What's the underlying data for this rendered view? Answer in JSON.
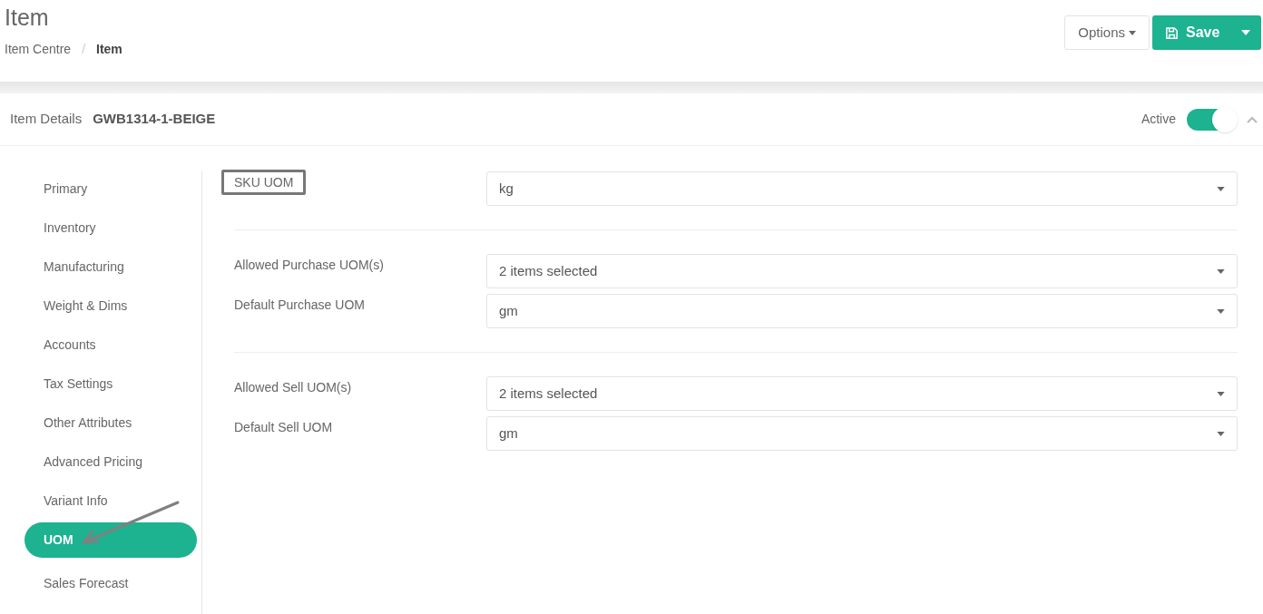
{
  "page": {
    "title": "Item",
    "breadcrumb": [
      {
        "label": "Item Centre",
        "current": false
      },
      {
        "label": "Item",
        "current": true
      }
    ],
    "separator": "/"
  },
  "actions": {
    "options": "Options",
    "save": "Save"
  },
  "details": {
    "label": "Item Details",
    "code": "GWB1314-1-BEIGE",
    "status_label": "Active",
    "active": true,
    "expanded": true
  },
  "sidebar": {
    "items": [
      {
        "label": "Primary",
        "selected": false
      },
      {
        "label": "Inventory",
        "selected": false
      },
      {
        "label": "Manufacturing",
        "selected": false
      },
      {
        "label": "Weight & Dims",
        "selected": false
      },
      {
        "label": "Accounts",
        "selected": false
      },
      {
        "label": "Tax Settings",
        "selected": false
      },
      {
        "label": "Other Attributes",
        "selected": false
      },
      {
        "label": "Advanced Pricing",
        "selected": false
      },
      {
        "label": "Variant Info",
        "selected": false
      },
      {
        "label": "UOM",
        "selected": true
      },
      {
        "label": "Sales Forecast",
        "selected": false
      }
    ]
  },
  "sections": [
    {
      "fields": [
        {
          "label": "SKU UOM",
          "value": "kg",
          "highlighted": true
        }
      ]
    },
    {
      "fields": [
        {
          "label": "Allowed Purchase UOM(s)",
          "value": "2 items selected",
          "highlighted": false
        },
        {
          "label": "Default Purchase UOM",
          "value": "gm",
          "highlighted": false
        }
      ]
    },
    {
      "fields": [
        {
          "label": "Allowed Sell UOM(s)",
          "value": "2 items selected",
          "highlighted": false
        },
        {
          "label": "Default Sell UOM",
          "value": "gm",
          "highlighted": false
        }
      ]
    }
  ]
}
